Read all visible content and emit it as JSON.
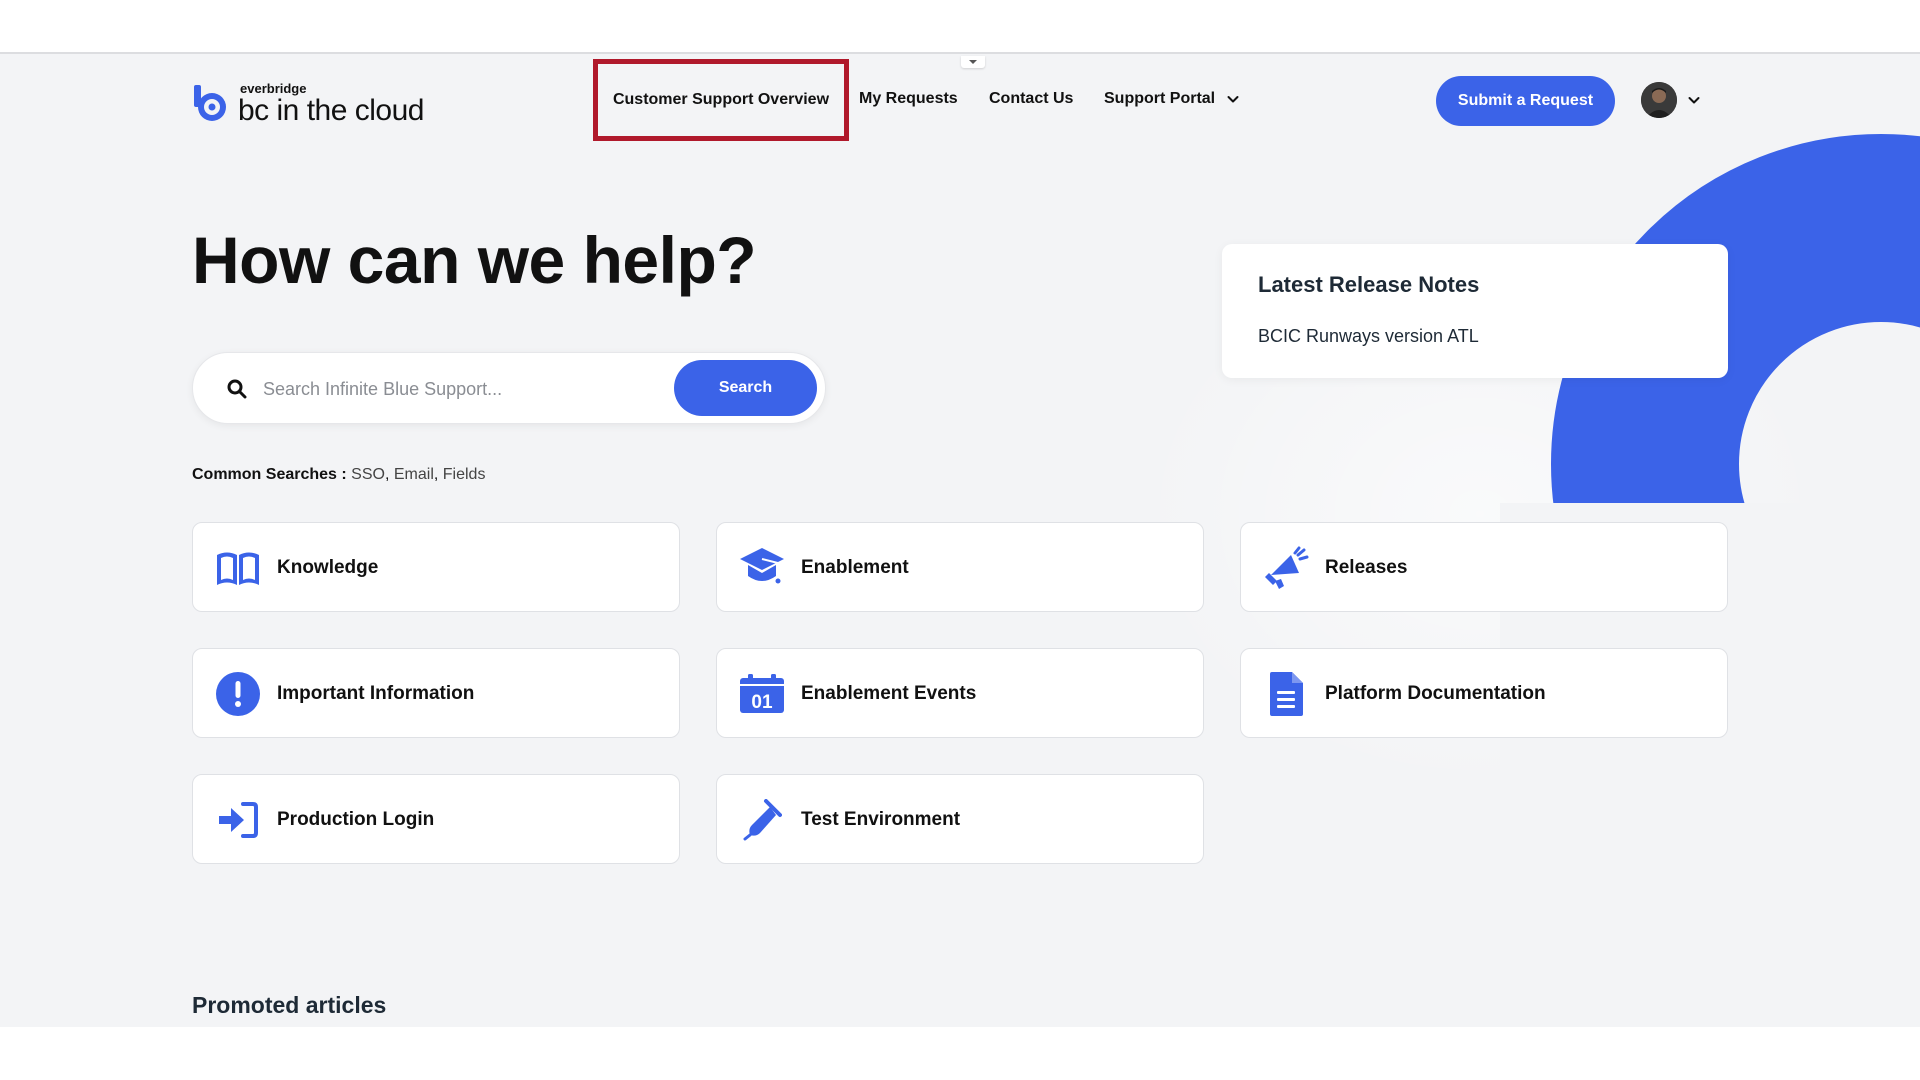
{
  "brand": {
    "company": "everbridge",
    "product": "bc in the cloud",
    "accent": "#3b63e8",
    "highlight_border": "#b0192b"
  },
  "nav": {
    "items": [
      {
        "label": "Customer Support Overview"
      },
      {
        "label": "My Requests"
      },
      {
        "label": "Contact Us"
      },
      {
        "label": "Support Portal"
      }
    ],
    "submit_label": "Submit a Request"
  },
  "hero": {
    "title": "How can we help?"
  },
  "search": {
    "placeholder": "Search Infinite Blue Support...",
    "value": "",
    "button_label": "Search"
  },
  "common_searches": {
    "label": "Common Searches :",
    "items": [
      "SSO",
      "Email",
      "Fields"
    ],
    "separator": ", "
  },
  "release_notes": {
    "title": "Latest Release Notes",
    "link": "BCIC Runways version ATL"
  },
  "tiles": [
    {
      "label": "Knowledge",
      "icon": "book-open-icon"
    },
    {
      "label": "Enablement",
      "icon": "graduation-cap-icon"
    },
    {
      "label": "Releases",
      "icon": "megaphone-icon"
    },
    {
      "label": "Important Information",
      "icon": "exclamation-circle-icon"
    },
    {
      "label": "Enablement Events",
      "icon": "calendar-icon",
      "icon_text": "01"
    },
    {
      "label": "Platform Documentation",
      "icon": "document-icon"
    },
    {
      "label": "Production Login",
      "icon": "sign-in-icon"
    },
    {
      "label": "Test Environment",
      "icon": "test-tube-icon"
    }
  ],
  "promoted": {
    "title": "Promoted articles"
  }
}
